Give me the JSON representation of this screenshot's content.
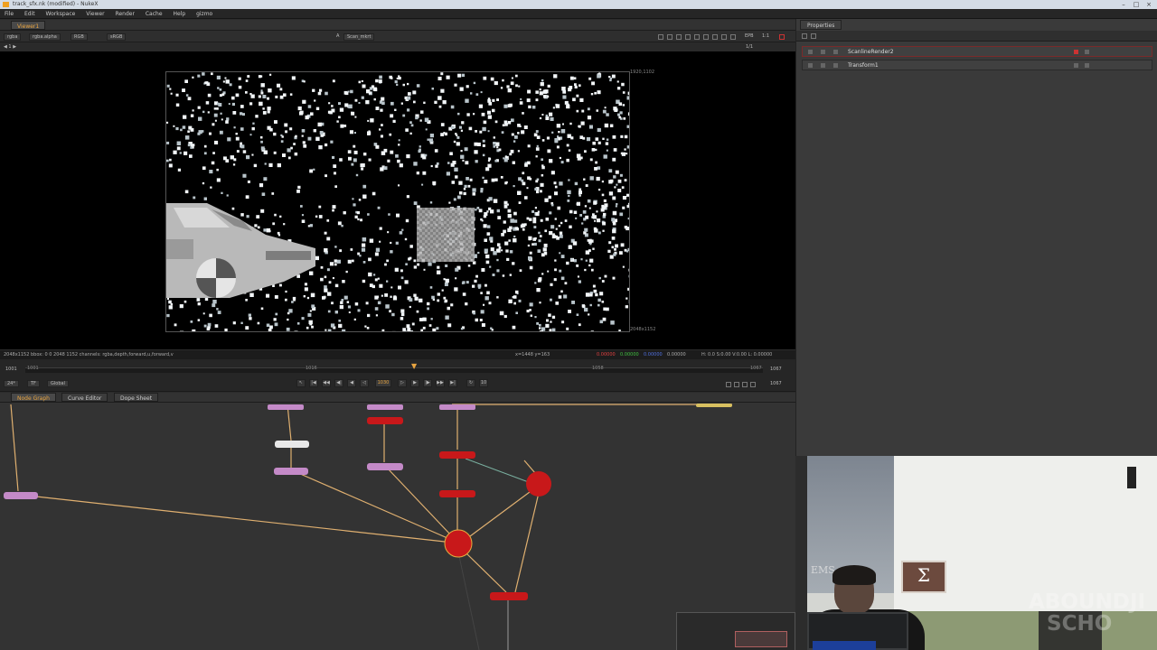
{
  "window": {
    "title": "track_sfx.nk (modified) - NukeX"
  },
  "menu": [
    "File",
    "Edit",
    "Workspace",
    "Viewer",
    "Render",
    "Cache",
    "Help",
    "gizmo"
  ],
  "viewer_tab": {
    "label": "Viewer1"
  },
  "viewer_controls": {
    "channels": "rgba",
    "layer": "rgba.alpha",
    "colorspace": "RGB",
    "wipe": "sRGB",
    "input_a": "A",
    "input_b": "Scan_mkrt",
    "zoom": "1:1",
    "proxy": "EPB",
    "scale": "1/1"
  },
  "viewer": {
    "format_top_right": "1920,1102",
    "format_bottom_right": "2048x1152"
  },
  "info_bar": {
    "left": "2048x1152 bbox: 0 0 2048 1152 channels: rgba,depth,forward,u,forward,v",
    "mid": "x=1448 y=163",
    "r": "0.00000",
    "g": "0.00000",
    "b": "0.00000",
    "a": "0.00000",
    "right": "H: 0.0 S:0.00 V:0.00 L: 0.00000"
  },
  "timeline": {
    "start": "1001",
    "mid": "1016",
    "end": "1058",
    "end2": "1067",
    "in": "1001",
    "out": "1067",
    "current_frame": "1030",
    "fps": "24*",
    "tf": "TF",
    "global": "Global",
    "left_marker": "1001"
  },
  "nodegraph_tabs": [
    "Node Graph",
    "Curve Editor",
    "Dope Sheet"
  ],
  "properties": {
    "tab": "Properties",
    "rows": [
      {
        "name": "ScanlineRender2"
      },
      {
        "name": "Transform1"
      }
    ]
  },
  "webcam": {
    "poster_text": "EMS",
    "badge": "Σ",
    "watermark_1": "ABOUNDJI",
    "watermark_2": "SCHO"
  },
  "colors": {
    "accent": "#e8a440",
    "node_red": "#c8181a",
    "node_purple": "#c48ac8",
    "wire": "#e0b070"
  }
}
